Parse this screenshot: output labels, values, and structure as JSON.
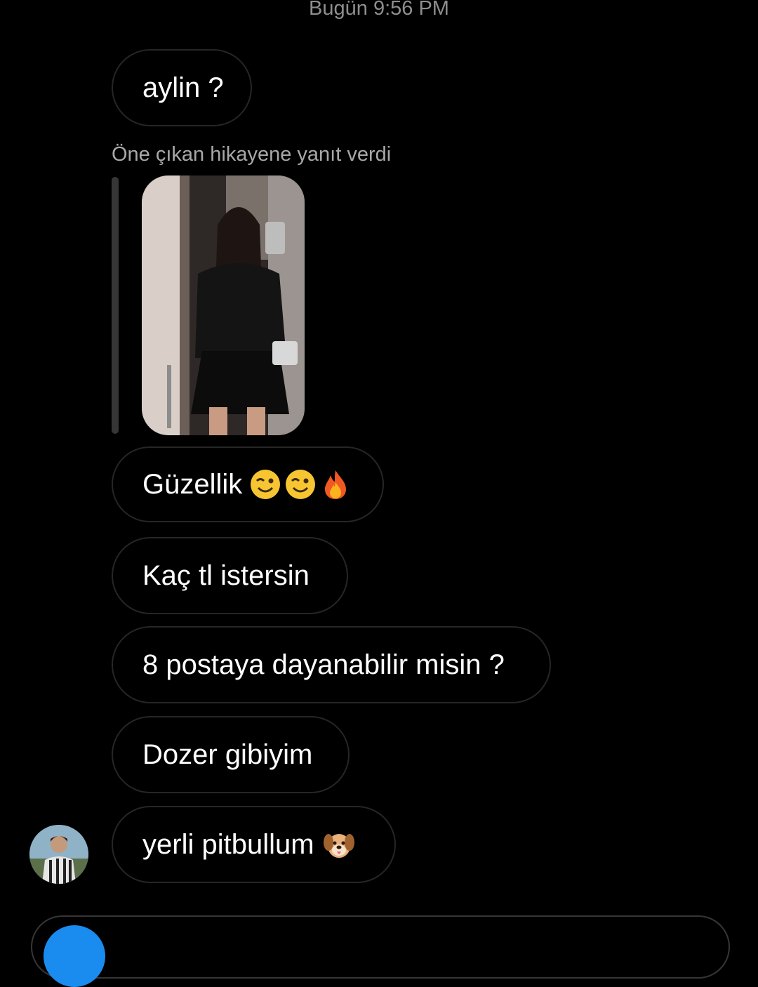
{
  "thread": {
    "timestamp": "Bugün 9:56 PM",
    "reply_label": "Öne çıkan hikayene yanıt verdi"
  },
  "messages": [
    {
      "text": "aylin ?",
      "emojis": []
    },
    {
      "text": "Güzellik",
      "emojis": [
        "winking-face",
        "winking-face",
        "fire"
      ]
    },
    {
      "text": "Kaç tl istersin",
      "emojis": []
    },
    {
      "text": "8 postaya dayanabilir misin ?",
      "emojis": []
    },
    {
      "text": "Dozer gibiyim",
      "emojis": []
    },
    {
      "text": "yerli pitbullum",
      "emojis": [
        "dog-face"
      ]
    }
  ],
  "icons": {
    "story_thumbnail": "story-photo",
    "sender_avatar": "avatar",
    "composer_camera": "camera-icon"
  },
  "colors": {
    "background": "#000000",
    "bubble_border": "#262626",
    "muted_text": "#8e8e8e",
    "accent": "#1a8cf0"
  }
}
